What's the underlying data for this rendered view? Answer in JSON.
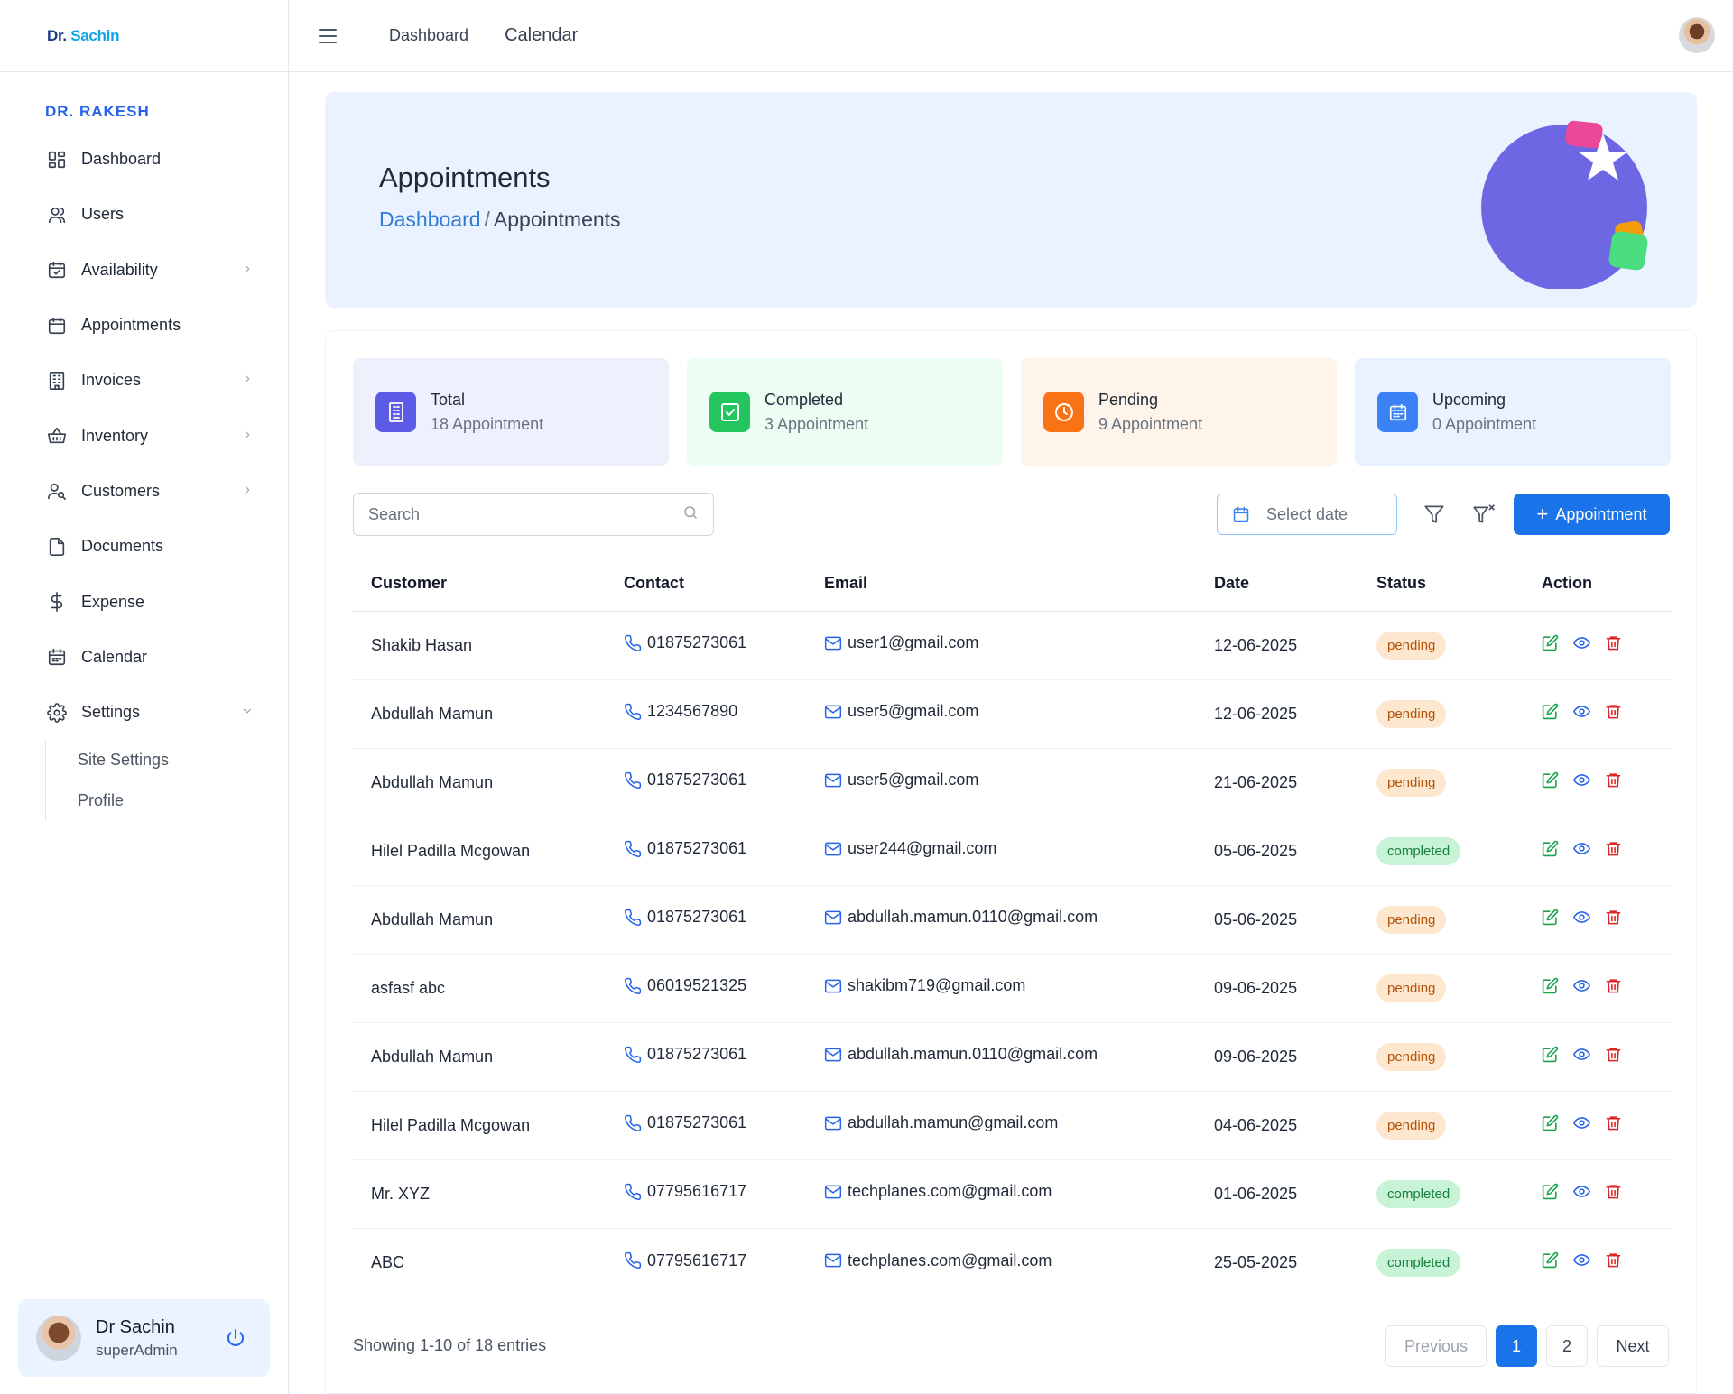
{
  "brand": {
    "logo_main": "Dr.",
    "logo_accent": "Sachin"
  },
  "sidebar": {
    "org_title": "DR. RAKESH",
    "items": [
      {
        "label": "Dashboard",
        "icon": "dashboard-icon",
        "has_chevron": false
      },
      {
        "label": "Users",
        "icon": "users-icon",
        "has_chevron": false
      },
      {
        "label": "Availability",
        "icon": "availability-icon",
        "has_chevron": true
      },
      {
        "label": "Appointments",
        "icon": "appointments-icon",
        "has_chevron": false
      },
      {
        "label": "Invoices",
        "icon": "invoices-icon",
        "has_chevron": true
      },
      {
        "label": "Inventory",
        "icon": "inventory-icon",
        "has_chevron": true
      },
      {
        "label": "Customers",
        "icon": "customers-icon",
        "has_chevron": true
      },
      {
        "label": "Documents",
        "icon": "documents-icon",
        "has_chevron": false
      },
      {
        "label": "Expense",
        "icon": "dollar-icon",
        "has_chevron": false
      },
      {
        "label": "Calendar",
        "icon": "calendar-icon",
        "has_chevron": false
      },
      {
        "label": "Settings",
        "icon": "gear-icon",
        "has_chevron": true,
        "expanded": true
      }
    ],
    "settings_sub": [
      "Site Settings",
      "Profile"
    ],
    "user": {
      "name": "Dr Sachin",
      "role": "superAdmin"
    }
  },
  "topbar": {
    "links": [
      "Dashboard",
      "Calendar"
    ]
  },
  "banner": {
    "title": "Appointments",
    "crumb_link": "Dashboard",
    "crumb_sep": "/",
    "crumb_current": "Appointments"
  },
  "stats": [
    {
      "title": "Total",
      "value": "18 Appointment",
      "bg": "#eef1fd",
      "icon_bg": "#5b5be6",
      "icon": "building-icon"
    },
    {
      "title": "Completed",
      "value": "3 Appointment",
      "bg": "#ecfdf3",
      "icon_bg": "#22c55e",
      "icon": "check-square-icon"
    },
    {
      "title": "Pending",
      "value": "9 Appointment",
      "bg": "#fff4ea",
      "icon_bg": "#f97316",
      "icon": "clock-icon"
    },
    {
      "title": "Upcoming",
      "value": "0 Appointment",
      "bg": "#eaf2ff",
      "icon_bg": "#3b82f6",
      "icon": "calendar-icon"
    }
  ],
  "toolbar": {
    "search_placeholder": "Search",
    "date_placeholder": "Select date",
    "add_label": "Appointment"
  },
  "table": {
    "headers": [
      "Customer",
      "Contact",
      "Email",
      "Date",
      "Status",
      "Action"
    ],
    "rows": [
      {
        "customer": "Shakib Hasan",
        "contact": "01875273061",
        "email": "user1@gmail.com",
        "date": "12-06-2025",
        "status": "pending"
      },
      {
        "customer": "Abdullah Mamun",
        "contact": "1234567890",
        "email": "user5@gmail.com",
        "date": "12-06-2025",
        "status": "pending"
      },
      {
        "customer": "Abdullah Mamun",
        "contact": "01875273061",
        "email": "user5@gmail.com",
        "date": "21-06-2025",
        "status": "pending"
      },
      {
        "customer": "Hilel Padilla Mcgowan",
        "contact": "01875273061",
        "email": "user244@gmail.com",
        "date": "05-06-2025",
        "status": "completed"
      },
      {
        "customer": "Abdullah Mamun",
        "contact": "01875273061",
        "email": "abdullah.mamun.0110@gmail.com",
        "date": "05-06-2025",
        "status": "pending"
      },
      {
        "customer": "asfasf abc",
        "contact": "06019521325",
        "email": "shakibm719@gmail.com",
        "date": "09-06-2025",
        "status": "pending"
      },
      {
        "customer": "Abdullah Mamun",
        "contact": "01875273061",
        "email": "abdullah.mamun.0110@gmail.com",
        "date": "09-06-2025",
        "status": "pending"
      },
      {
        "customer": "Hilel Padilla Mcgowan",
        "contact": "01875273061",
        "email": "abdullah.mamun@gmail.com",
        "date": "04-06-2025",
        "status": "pending"
      },
      {
        "customer": "Mr. XYZ",
        "contact": "07795616717",
        "email": "techplanes.com@gmail.com",
        "date": "01-06-2025",
        "status": "completed"
      },
      {
        "customer": "ABC",
        "contact": "07795616717",
        "email": "techplanes.com@gmail.com",
        "date": "25-05-2025",
        "status": "completed"
      }
    ]
  },
  "footer": {
    "info": "Showing 1-10 of 18 entries",
    "prev": "Previous",
    "pages": [
      "1",
      "2"
    ],
    "active_page": "1",
    "next": "Next"
  }
}
